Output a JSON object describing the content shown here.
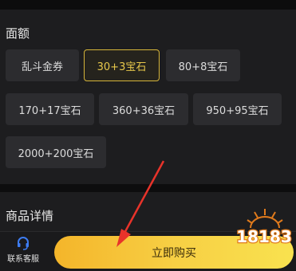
{
  "denomination": {
    "title": "面额",
    "options": [
      {
        "label": "乱斗金券"
      },
      {
        "label": "30+3宝石"
      },
      {
        "label": "80+8宝石"
      },
      {
        "label": "170+17宝石"
      },
      {
        "label": "360+36宝石"
      },
      {
        "label": "950+95宝石"
      },
      {
        "label": "2000+200宝石"
      }
    ],
    "selected": "30+3宝石"
  },
  "details": {
    "title": "商品详情"
  },
  "footer": {
    "customer_service": "联系客服",
    "buy_label": "立即购买"
  },
  "watermark": {
    "text": "18183"
  },
  "colors": {
    "selected_border": "#d6b53a",
    "buy_gradient_start": "#f4b52a",
    "buy_gradient_end": "#f9e24f",
    "arrow": "#e8332a",
    "cs_icon": "#3d7cf2"
  },
  "icons": {
    "customer_service": "headset-icon",
    "annotation": "red-arrow"
  }
}
